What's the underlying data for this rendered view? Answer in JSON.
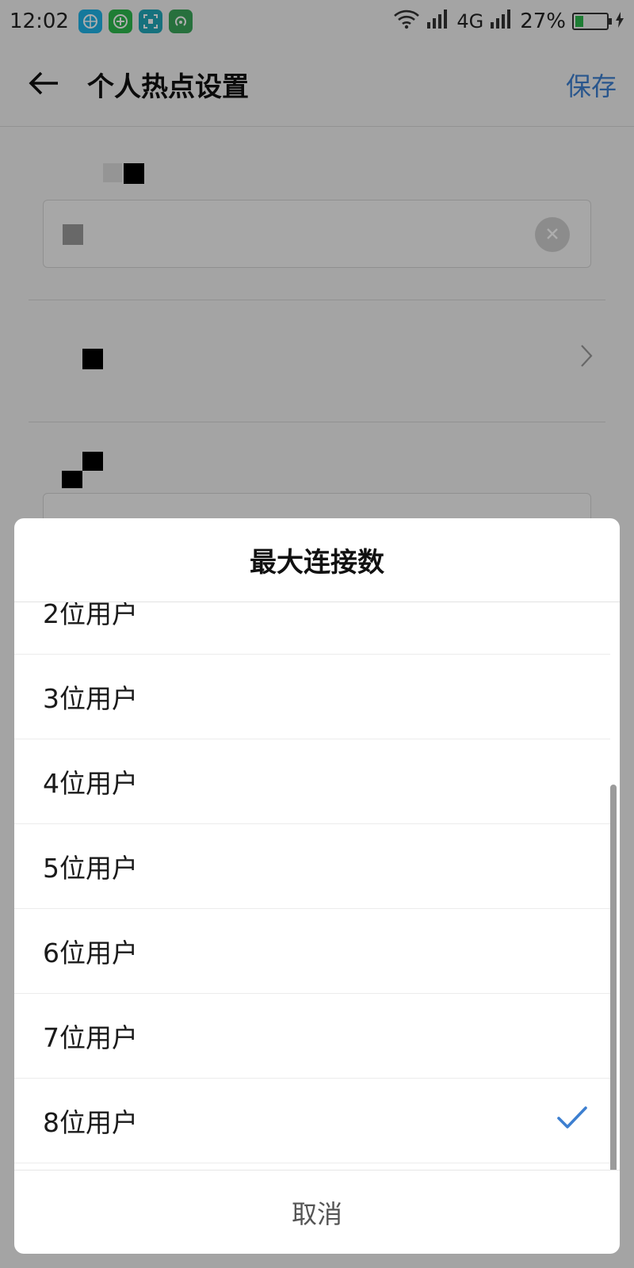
{
  "status_bar": {
    "time": "12:02",
    "network_label": "4G",
    "battery_text": "27%",
    "battery_level": 0.27,
    "apps": [
      {
        "icon": "basketball-icon",
        "color": "#1fb3e6"
      },
      {
        "icon": "plus-circle-icon",
        "color": "#2db84d"
      },
      {
        "icon": "scan-icon",
        "color": "#21a7b8"
      },
      {
        "icon": "hotspot-icon",
        "color": "#3aa65b"
      }
    ]
  },
  "header": {
    "title": "个人热点设置",
    "save_label": "保存",
    "accent_color": "#3d7fd0"
  },
  "dialog": {
    "title": "最大连接数",
    "options": [
      {
        "label": "2位用户",
        "selected": false
      },
      {
        "label": "3位用户",
        "selected": false
      },
      {
        "label": "4位用户",
        "selected": false
      },
      {
        "label": "5位用户",
        "selected": false
      },
      {
        "label": "6位用户",
        "selected": false
      },
      {
        "label": "7位用户",
        "selected": false
      },
      {
        "label": "8位用户",
        "selected": true
      }
    ],
    "cancel_label": "取消"
  }
}
